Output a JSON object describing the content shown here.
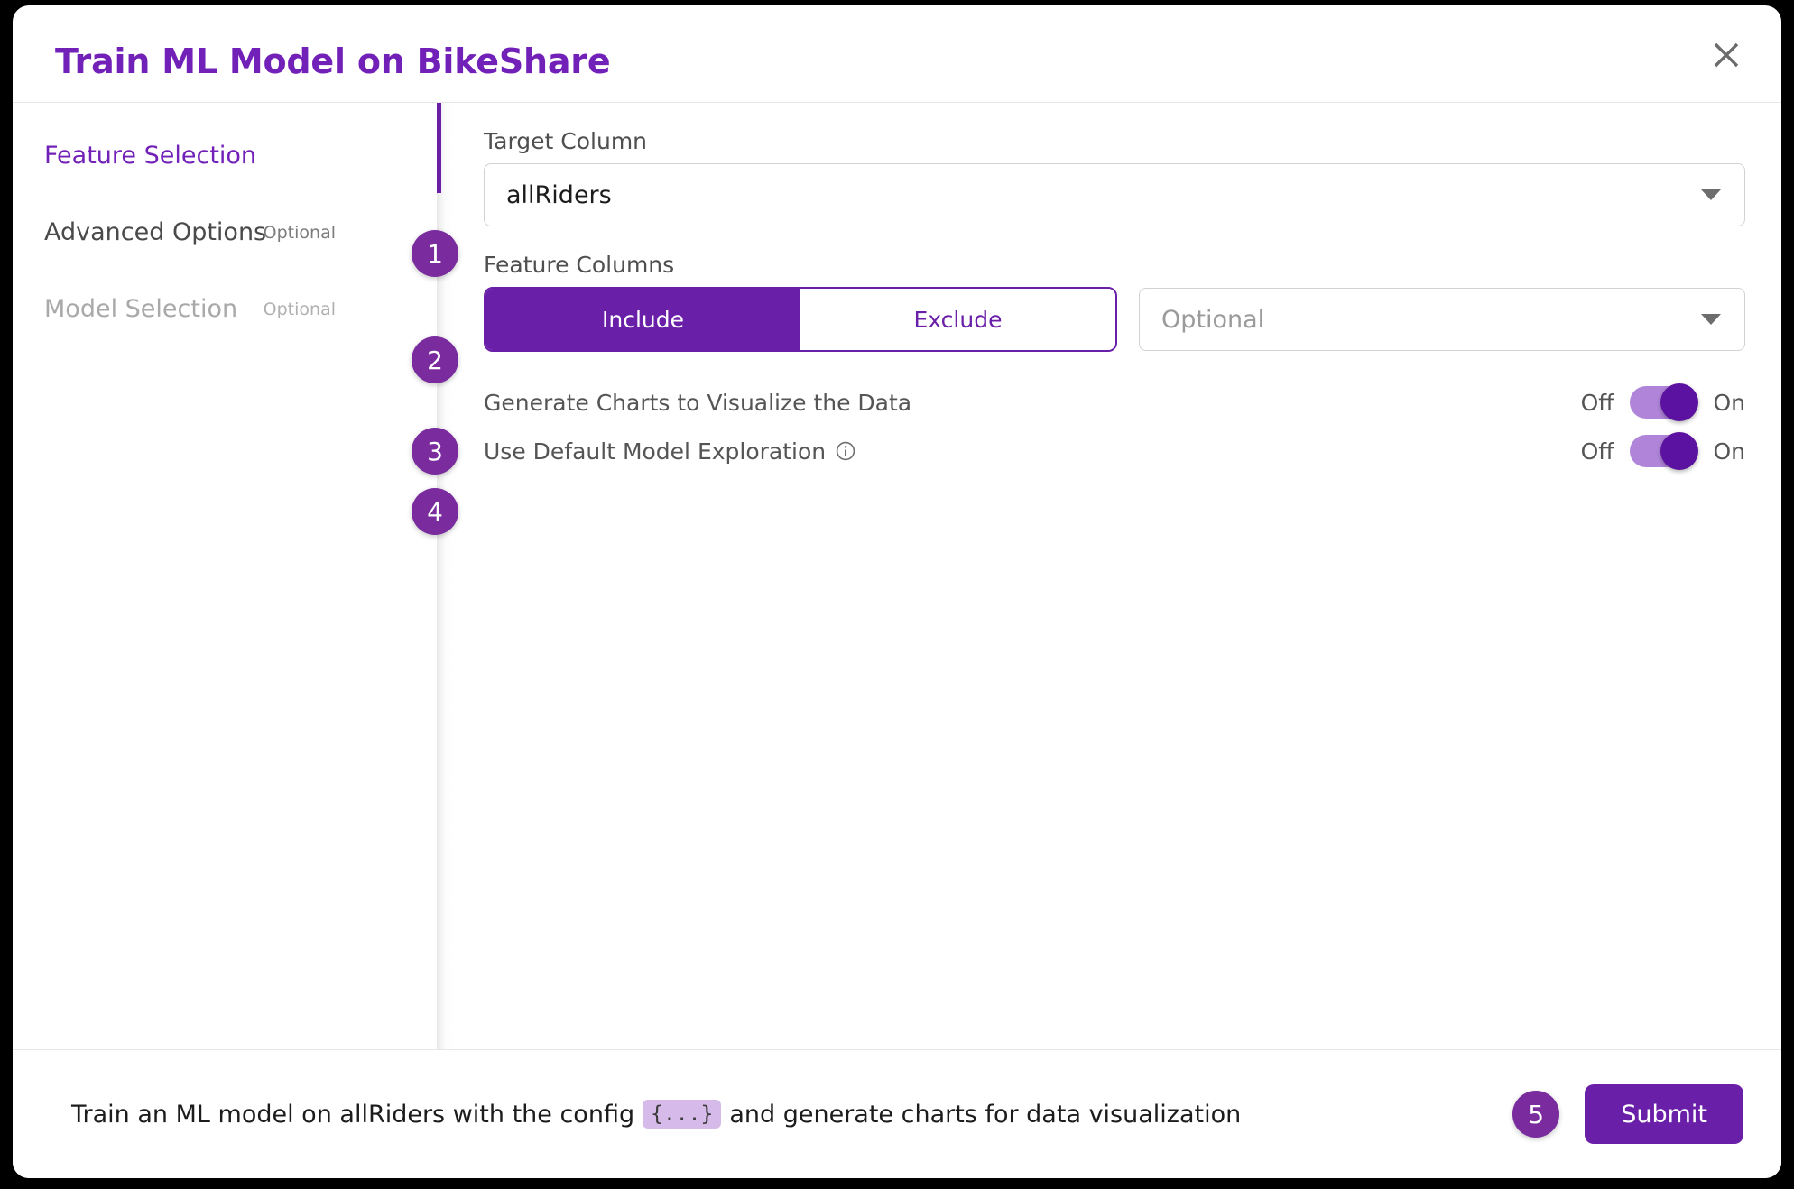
{
  "dialog": {
    "title": "Train ML Model on BikeShare",
    "close_icon": "close-icon"
  },
  "sidebar": {
    "items": [
      {
        "label": "Feature Selection",
        "optional": ""
      },
      {
        "label": "Advanced Options",
        "optional": "Optional"
      },
      {
        "label": "Model Selection",
        "optional": "Optional"
      }
    ]
  },
  "main": {
    "target_column": {
      "label": "Target Column",
      "value": "allRiders",
      "caret_icon": "chevron-down-icon",
      "step": "1"
    },
    "feature_columns": {
      "label": "Feature Columns",
      "include_label": "Include",
      "exclude_label": "Exclude",
      "selected_mode": "Include",
      "columns_placeholder": "Optional",
      "columns_value": "",
      "caret_icon": "chevron-down-icon",
      "step": "2"
    },
    "generate_charts": {
      "label": "Generate Charts to Visualize the Data",
      "off_label": "Off",
      "on_label": "On",
      "state": "On",
      "step": "3"
    },
    "default_exploration": {
      "label": "Use Default Model Exploration",
      "info_icon": "info-circle-icon",
      "off_label": "Off",
      "on_label": "On",
      "state": "On",
      "step": "4"
    }
  },
  "footer": {
    "summary_prefix": "Train an ML model on allRiders with the config",
    "config_chip": "{...}",
    "summary_suffix": "and generate charts for data visualization",
    "submit_label": "Submit",
    "step": "5"
  },
  "colors": {
    "brand_purple": "#6a1fa8",
    "title_purple": "#7221b8",
    "badge_purple": "#7a2b9e",
    "track_purple": "#b084d8",
    "chip_purple": "#d6bbea"
  }
}
